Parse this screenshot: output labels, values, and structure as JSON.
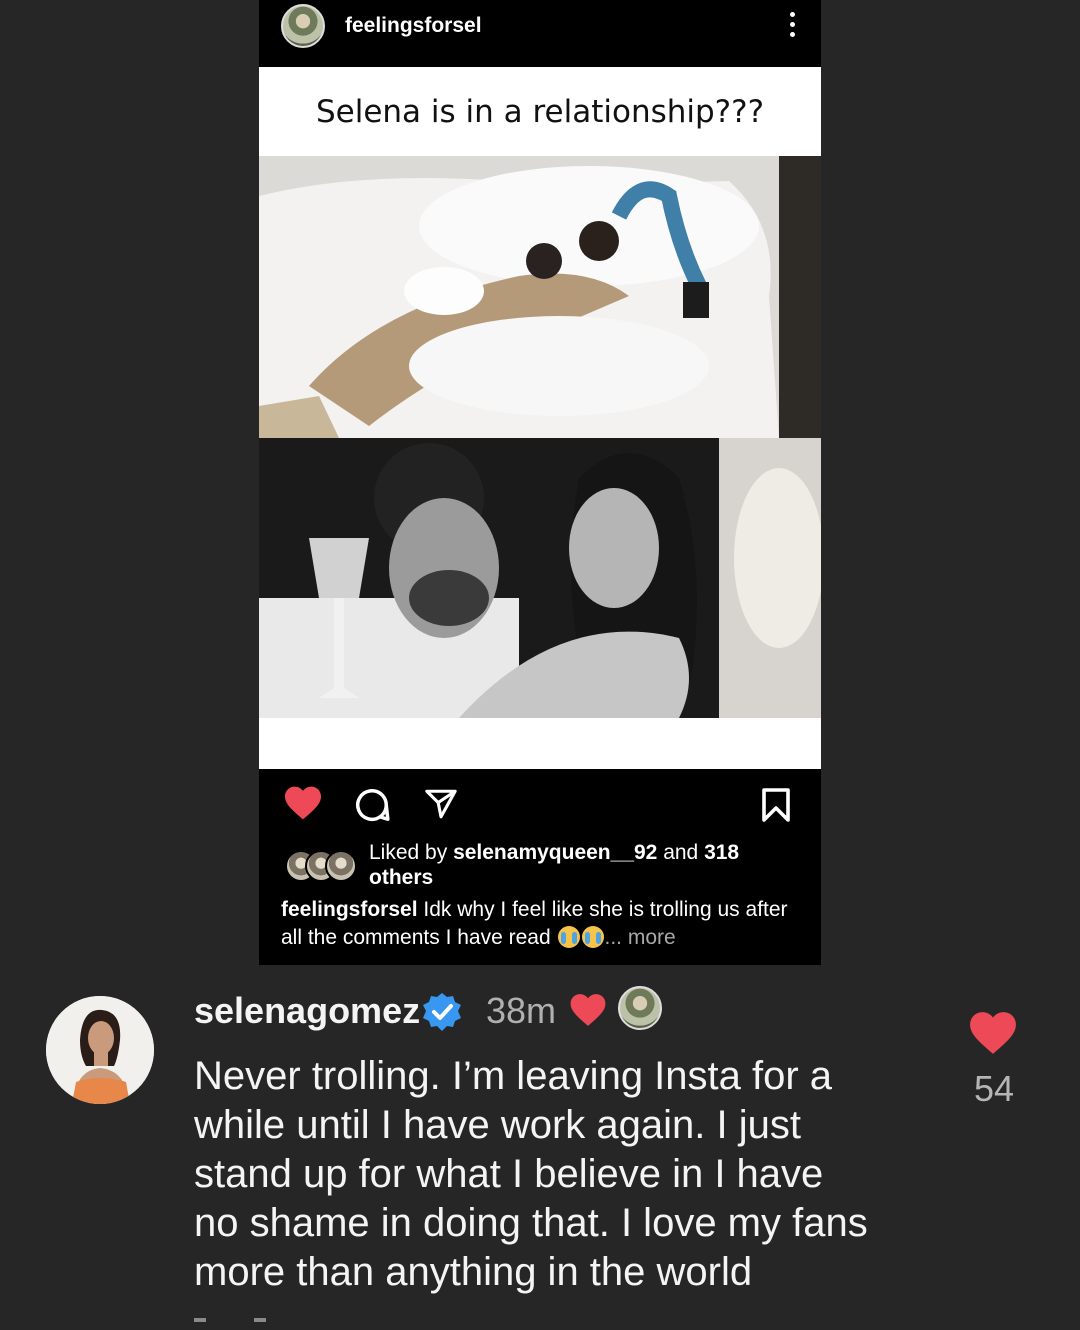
{
  "post": {
    "username": "feelingsforsel",
    "caption_banner": "Selena is in a relationship???",
    "liked_by_prefix": "Liked by ",
    "liked_by_user": "selenamyqueen__92",
    "liked_by_suffix": " and ",
    "liked_by_count": "318",
    "liked_by_others": "others",
    "caption_user": "feelingsforsel",
    "caption_text": " Idk why I feel like she is trolling us after all the comments I have read ",
    "caption_more": "... more",
    "liked": true
  },
  "comment": {
    "username": "selenagomez",
    "verified": true,
    "time": "38m",
    "liked_by_creator": true,
    "text": "Never trolling. I’m leaving Insta for a\nwhile until I have work again. I just\nstand up for what I believe in  I have\nno shame in doing that. I love my fans\nmore than anything in the world",
    "like_count": "54"
  },
  "icons": {
    "menu": "more-vertical-icon",
    "like": "heart-icon",
    "comment": "comment-icon",
    "share": "send-icon",
    "save": "bookmark-icon"
  },
  "colors": {
    "background": "#262626",
    "heart_red": "#ed4956",
    "verified_blue": "#3897f0"
  }
}
